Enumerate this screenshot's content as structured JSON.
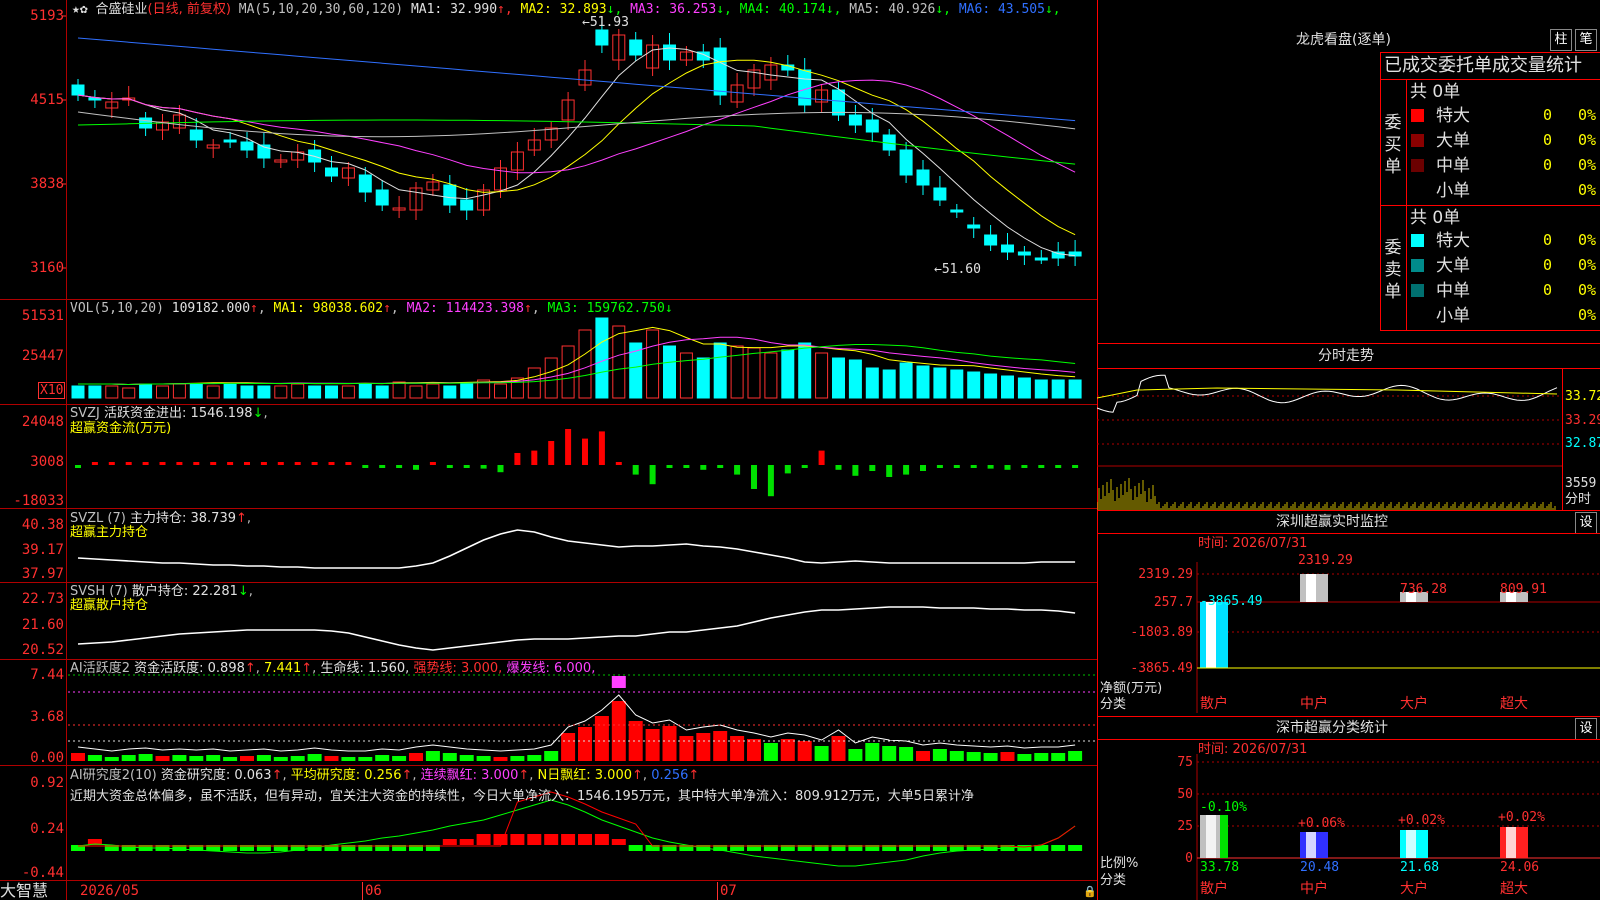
{
  "stock": {
    "name": "合盛硅业",
    "period": "(日线, 前复权)",
    "stars": "★✿"
  },
  "ma": {
    "label": "MA(5,10,20,30,60,120)",
    "items": [
      {
        "t": "MA1: 32.990",
        "a": "↑",
        "c": "#e0e0e0"
      },
      {
        "t": "MA2: 32.893",
        "a": "↓",
        "c": "#ffff00"
      },
      {
        "t": "MA3: 36.253",
        "a": "↓",
        "c": "#ff40ff"
      },
      {
        "t": "MA4: 40.174",
        "a": "↓",
        "c": "#00ff00"
      },
      {
        "t": "MA5: 40.926",
        "a": "↓",
        "c": "#c0c0c0"
      },
      {
        "t": "MA6: 43.505",
        "a": "↓",
        "c": "#3070ff"
      }
    ]
  },
  "price_axis": [
    "5193",
    "4515",
    "3838",
    "3160"
  ],
  "price_hi": "51.93",
  "price_lo": "51.60",
  "vol": {
    "label": "VOL(5,10,20)",
    "val": "109182.000",
    "ma1": "MA1: 98038.602",
    "ma2": "MA2: 114423.398",
    "ma3": "MA3: 159762.750",
    "axis": [
      "51531",
      "25447"
    ],
    "x10": "X10"
  },
  "svzj": {
    "label": "SVZJ",
    "desc": "活跃资金进出: 1546.198",
    "sub": "超赢资金流(万元)",
    "axis": [
      "24048",
      "3008",
      "-18033"
    ]
  },
  "svzl": {
    "label": "SVZL (7)",
    "desc": "主力持仓: 38.739",
    "sub": "超赢主力持仓",
    "axis": [
      "40.38",
      "39.17",
      "37.97"
    ]
  },
  "svsh": {
    "label": "SVSH (7)",
    "desc": "散户持仓: 22.281",
    "sub": "超赢散户持仓",
    "axis": [
      "22.73",
      "21.60",
      "20.52"
    ]
  },
  "ai1": {
    "label": "AI活跃度2",
    "p1": "资金活跃度: 0.898",
    "p2": "7.441",
    "p3": "生命线: 1.560,",
    "p4": "强势线: 3.000,",
    "p5": "爆发线: 6.000,",
    "axis": [
      "7.44",
      "3.68",
      "0.00"
    ]
  },
  "ai2": {
    "label": "AI研究度2(10)",
    "p1": "资金研究度: 0.063",
    "p2": "平均研究度: 0.256",
    "p3": "连续飘红: 3.000",
    "p4": "N日飘红: 3.000",
    "p5": "0.256",
    "axis": [
      "0.92",
      "0.24",
      "-0.44"
    ],
    "comment": "近期大资金总体偏多，虽不活跃，但有异动，宜关注大资金的持续性，今日大单净流入：1546.195万元，其中特大单净流入：809.912万元，大单5日累计净"
  },
  "dates": [
    "2026/05",
    "06",
    "07"
  ],
  "brand": "大智慧",
  "lhb": {
    "title": "龙虎看盘(逐单)",
    "btn1": "柱",
    "btn2": "笔",
    "header": "已成交委托单成交量统计",
    "buy_label": "委买单",
    "sell_label": "委卖单",
    "total": "共 0单",
    "rows": [
      "特大",
      "大单",
      "中单",
      "小单"
    ],
    "zero": "0",
    "pct": "0%",
    "buy_colors": [
      "#ff0000",
      "#8b0000",
      "#6b0000",
      ""
    ],
    "sell_colors": [
      "#00ffff",
      "#008b8b",
      "#007070",
      ""
    ]
  },
  "fenshi": {
    "title": "分时走势",
    "axis": [
      "33.72",
      "33.29",
      "32.87",
      "3559"
    ],
    "label": "分时"
  },
  "sz": {
    "title": "深圳超赢实时监控",
    "btn": "设",
    "time": "时间: 2026/07/31",
    "axis": [
      "2319.29",
      "257.7",
      "-1803.89",
      "-3865.49"
    ],
    "bar_labels": [
      "-3865.49",
      "2319.29",
      "736.28",
      "809.91"
    ],
    "cats": [
      "散户",
      "中户",
      "大户",
      "超大"
    ],
    "ylab": "净额(万元)",
    "xlab": "分类"
  },
  "ss": {
    "title": "深市超赢分类统计",
    "btn": "设",
    "time": "时间: 2026/07/31",
    "axis": [
      "75",
      "50",
      "25",
      "0"
    ],
    "bar_labels": [
      "-0.10%",
      "+0.06%",
      "+0.02%",
      "+0.02%"
    ],
    "vals": [
      "33.78",
      "20.48",
      "21.68",
      "24.06"
    ],
    "cats": [
      "散户",
      "中户",
      "大户",
      "超大"
    ],
    "ylab": "比例%",
    "xlab": "分类"
  }
}
